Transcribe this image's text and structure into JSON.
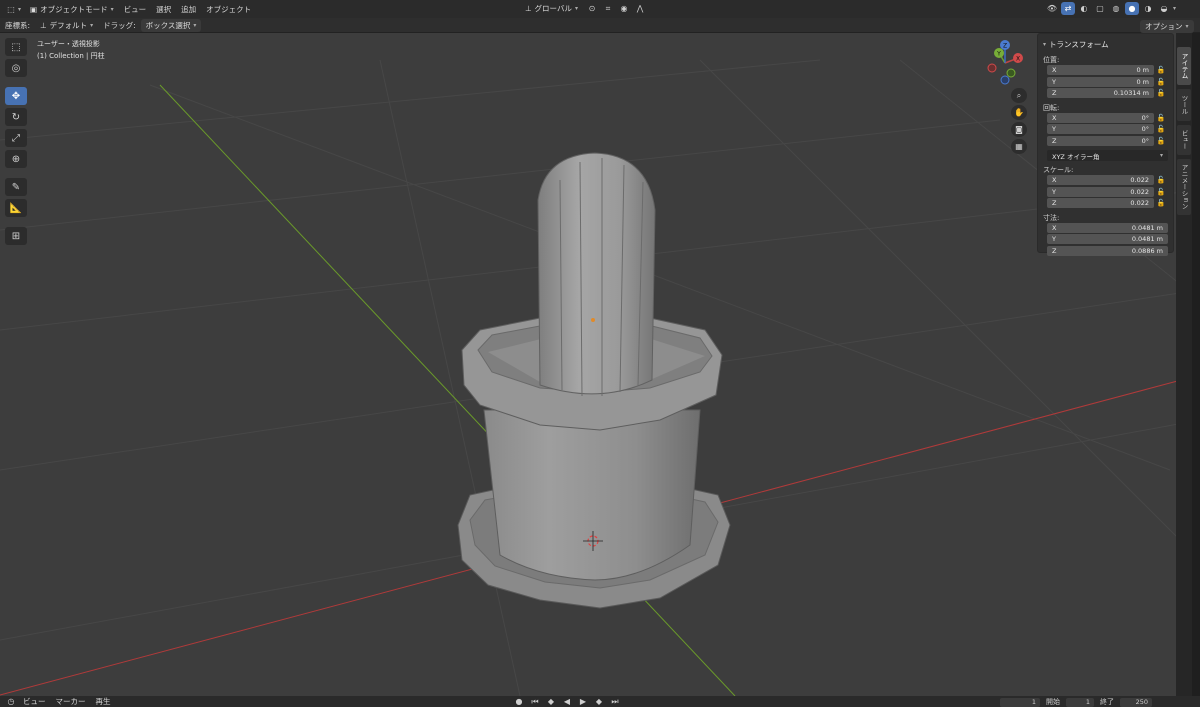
{
  "header": {
    "mode_label": "オブジェクトモード",
    "menu": [
      "ビュー",
      "選択",
      "追加",
      "オブジェクト"
    ],
    "transform_orientation": "グローバル",
    "options_label": "オプション"
  },
  "toolbar": {
    "orientation_label": "座標系:",
    "orientation_value": "デフォルト",
    "drag_label": "ドラッグ:",
    "drag_value": "ボックス選択"
  },
  "viewport": {
    "view_name": "ユーザー・透視投影",
    "collection_info": "(1) Collection | 円柱"
  },
  "gizmo": {
    "x": "X",
    "y": "Y",
    "z": "Z"
  },
  "npanel": {
    "section_title": "トランスフォーム",
    "location_label": "位置:",
    "location": [
      {
        "axis": "X",
        "value": "0 m"
      },
      {
        "axis": "Y",
        "value": "0 m"
      },
      {
        "axis": "Z",
        "value": "0.10314 m"
      }
    ],
    "rotation_label": "回転:",
    "rotation": [
      {
        "axis": "X",
        "value": "0°"
      },
      {
        "axis": "Y",
        "value": "0°"
      },
      {
        "axis": "Z",
        "value": "0°"
      }
    ],
    "rotation_mode": "XYZ オイラー角",
    "scale_label": "スケール:",
    "scale": [
      {
        "axis": "X",
        "value": "0.022"
      },
      {
        "axis": "Y",
        "value": "0.022"
      },
      {
        "axis": "Z",
        "value": "0.022"
      }
    ],
    "dimensions_label": "寸法:",
    "dimensions": [
      {
        "axis": "X",
        "value": "0.0481 m"
      },
      {
        "axis": "Y",
        "value": "0.0481 m"
      },
      {
        "axis": "Z",
        "value": "0.0886 m"
      }
    ]
  },
  "sidebar_tabs": [
    "アイテム",
    "ツール",
    "ビュー",
    "アニメーション"
  ],
  "timeline": {
    "menu": [
      "ビュー",
      "マーカー",
      "再生"
    ],
    "current_frame": "1",
    "start_label": "開始",
    "start_value": "1",
    "end_label": "終了",
    "end_value": "250"
  },
  "colors": {
    "accent": "#4772b3",
    "viewport_bg": "#3d3d3d",
    "axis_x": "#b03a3a",
    "axis_y": "#6a9a2a",
    "panel_bg": "#303030"
  }
}
